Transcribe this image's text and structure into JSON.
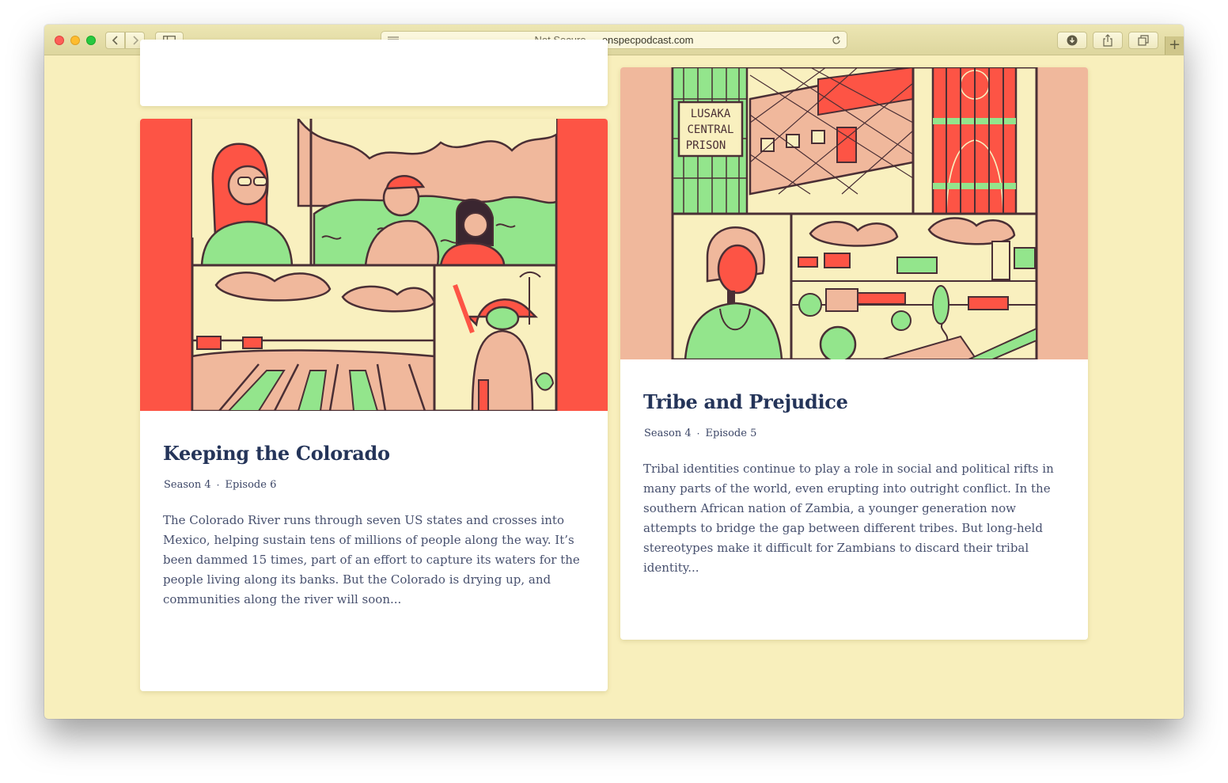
{
  "browser": {
    "url_prefix": "Not Secure —",
    "url_domain": "onspecpodcast.com",
    "new_tab_symbol": "+"
  },
  "episodes": [
    {
      "title": "Keeping the Colorado",
      "season": "Season 4",
      "episode": "Episode 6",
      "separator": "·",
      "description": "The Colorado River runs through seven US states and crosses into Mexico, helping sustain tens of millions of people along the way. It’s been dammed 15 times, part of an effort to capture its waters for the people living along its banks. But the Colorado is drying up, and communities along the river will soon..."
    },
    {
      "title": "Tribe and Prejudice",
      "season": "Season 4",
      "episode": "Episode 5",
      "separator": "·",
      "description": "Tribal identities continue to play a role in social and political rifts in many parts of the world, even erupting into outright conflict. In the southern African nation of Zambia, a younger generation now attempts to bridge the gap between different tribes. But long-held stereotypes make it difficult for Zambians to discard their tribal identity...",
      "illustration_sign": [
        "LUSAKA",
        "CENTRAL",
        "PRISON"
      ]
    }
  ],
  "colors": {
    "page_background": "#f8efbc",
    "title": "#243459",
    "accent_red": "#fd5445",
    "accent_green": "#93e58c",
    "accent_peach": "#f0b89c"
  }
}
